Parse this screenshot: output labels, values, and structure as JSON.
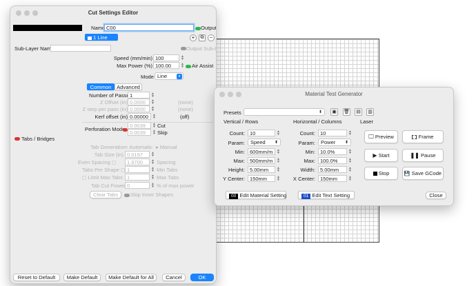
{
  "background": {
    "grid_color": "#d4d4d4"
  },
  "cut_settings": {
    "title": "Cut Settings Editor",
    "name_label": "Name",
    "name_value": "C00",
    "output_label": "Output",
    "layer_chip": "1 Line",
    "sublayer_label": "Sub-Layer Name",
    "output_sublayer_label": "Output Sub-Layer",
    "speed_label": "Speed (mm/min)",
    "speed_value": "100",
    "max_power_label": "Max Power (%)",
    "max_power_value": "100.00",
    "air_assist_label": "Air Assist",
    "mode_label": "Mode",
    "mode_value": "Line",
    "tab_common": "Common",
    "tab_advanced": "Advanced",
    "passes_label": "Number of Passes",
    "passes_value": "1",
    "z_offset_label": "Z Offset (in)",
    "z_offset_value": "0.0000",
    "z_offset_note": "(none)",
    "z_step_label": "Z step per pass (in)",
    "z_step_value": "0.0000",
    "z_step_note": "(none)",
    "kerf_label": "Kerf offset (in)",
    "kerf_value": "0.00000",
    "kerf_note": "(off)",
    "perforation_label": "Perforation Mode",
    "perf_cut_value": "0.0039",
    "perf_cut_label": "Cut",
    "perf_skip_value": "0.0039",
    "perf_skip_label": "Skip",
    "tabs_bridges_label": "Tabs / Bridges",
    "tab_generation_label": "Tab Generation",
    "automatic_label": "Automatic",
    "manual_label": "Manual",
    "tab_size_label": "Tab Size (in)",
    "tab_size_value": "0.0197",
    "even_spacing_label": "Even Spacing",
    "spacing_value": "1.9700",
    "spacing_label": "Spacing",
    "tabs_per_shape_label": "Tabs Per Shape",
    "tabs_per_shape_value": "1",
    "min_tabs_label": "Min Tabs",
    "limit_max_tabs_label": "Limit Max Tabs",
    "max_tabs_value": "1",
    "max_tabs_label": "Max Tabs",
    "tab_cut_power_label": "Tab Cut Power",
    "tab_cut_power_value": "0",
    "tab_cut_power_unit": "% of max power",
    "clear_tabs_label": "Clear Tabs",
    "skip_inner_label": "Skip Inner Shapes",
    "reset_default": "Reset to Default",
    "make_default": "Make Default",
    "make_default_all": "Make Default for All",
    "cancel": "Cancel",
    "ok": "OK"
  },
  "material_test": {
    "title": "Material Test Generator",
    "presets_label": "Presets",
    "vertical_header": "Vertical / Rows",
    "horizontal_header": "Horizontal / Columns",
    "laser_header": "Laser",
    "count_label": "Count:",
    "param_label": "Param:",
    "min_label": "Min:",
    "max_label": "Max:",
    "height_label": "Height:",
    "width_label": "Width:",
    "y_center_label": "Y Center:",
    "x_center_label": "X Center:",
    "v_count": "10",
    "v_param": "Speed",
    "v_min": "600mm/m",
    "v_max": "500mm/m",
    "v_height": "5.00mm",
    "v_center": "150mm",
    "h_count": "10",
    "h_param": "Power",
    "h_min": "10.0%",
    "h_max": "100.0%",
    "h_width": "5.00mm",
    "h_center": "150mm",
    "preview": "Preview",
    "frame": "Frame",
    "start": "Start",
    "pause": "Pause",
    "stop": "Stop",
    "save_gcode": "Save GCode",
    "edit_material_num": "00",
    "edit_material": "Edit Material Setting",
    "edit_text_num": "01",
    "edit_text": "Edit Text Setting",
    "close": "Close"
  }
}
